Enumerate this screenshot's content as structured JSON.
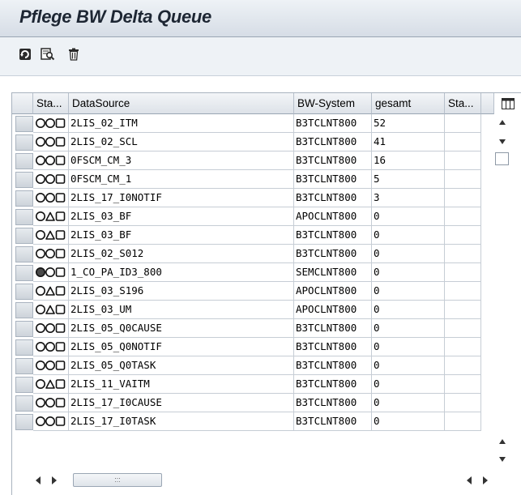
{
  "window": {
    "title": "Pflege BW Delta Queue"
  },
  "toolbar": {
    "buttons": [
      {
        "name": "refresh-icon"
      },
      {
        "name": "detail-search-icon"
      },
      {
        "name": "delete-trash-icon"
      }
    ]
  },
  "grid": {
    "columns": [
      "Sta...",
      "DataSource",
      "BW-System",
      "gesamt",
      "Sta..."
    ],
    "rows": [
      {
        "status": "green",
        "datasource": "2LIS_02_ITM",
        "bw_system": "B3TCLNT800",
        "gesamt": "52"
      },
      {
        "status": "green",
        "datasource": "2LIS_02_SCL",
        "bw_system": "B3TCLNT800",
        "gesamt": "41"
      },
      {
        "status": "green",
        "datasource": "0FSCM_CM_3",
        "bw_system": "B3TCLNT800",
        "gesamt": "16"
      },
      {
        "status": "green",
        "datasource": "0FSCM_CM_1",
        "bw_system": "B3TCLNT800",
        "gesamt": "5"
      },
      {
        "status": "green",
        "datasource": "2LIS_17_I0NOTIF",
        "bw_system": "B3TCLNT800",
        "gesamt": "3"
      },
      {
        "status": "yellow",
        "datasource": "2LIS_03_BF",
        "bw_system": "APOCLNT800",
        "gesamt": "0"
      },
      {
        "status": "yellow",
        "datasource": "2LIS_03_BF",
        "bw_system": "B3TCLNT800",
        "gesamt": "0"
      },
      {
        "status": "green",
        "datasource": "2LIS_02_S012",
        "bw_system": "B3TCLNT800",
        "gesamt": "0"
      },
      {
        "status": "red",
        "datasource": "1_CO_PA_ID3_800",
        "bw_system": "SEMCLNT800",
        "gesamt": "0"
      },
      {
        "status": "yellow",
        "datasource": "2LIS_03_S196",
        "bw_system": "APOCLNT800",
        "gesamt": "0"
      },
      {
        "status": "yellow",
        "datasource": "2LIS_03_UM",
        "bw_system": "APOCLNT800",
        "gesamt": "0"
      },
      {
        "status": "green",
        "datasource": "2LIS_05_Q0CAUSE",
        "bw_system": "B3TCLNT800",
        "gesamt": "0"
      },
      {
        "status": "green",
        "datasource": "2LIS_05_Q0NOTIF",
        "bw_system": "B3TCLNT800",
        "gesamt": "0"
      },
      {
        "status": "green",
        "datasource": "2LIS_05_Q0TASK",
        "bw_system": "B3TCLNT800",
        "gesamt": "0"
      },
      {
        "status": "yellow",
        "datasource": "2LIS_11_VAITM",
        "bw_system": "B3TCLNT800",
        "gesamt": "0"
      },
      {
        "status": "green",
        "datasource": "2LIS_17_I0CAUSE",
        "bw_system": "B3TCLNT800",
        "gesamt": "0"
      },
      {
        "status": "green",
        "datasource": "2LIS_17_I0TASK",
        "bw_system": "B3TCLNT800",
        "gesamt": "0"
      }
    ]
  },
  "colors": {
    "title_bar": "#d6dde6",
    "light_off": "#ffffff",
    "light_dark": "#4a4a4a",
    "border": "#a9b3bf"
  },
  "hscroll": {
    "grip": ":::"
  }
}
